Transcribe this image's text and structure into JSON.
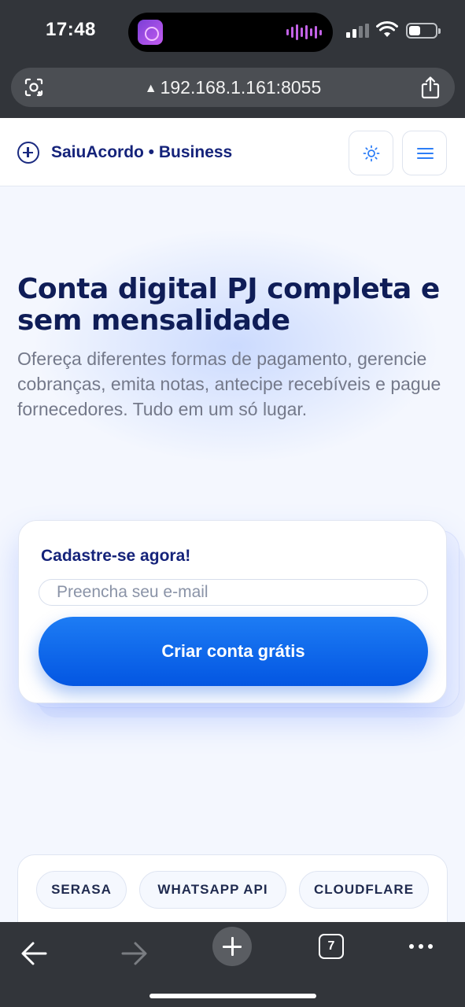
{
  "status_bar": {
    "time": "17:48"
  },
  "browser": {
    "url": "192.168.1.161:8055",
    "tab_count": "7"
  },
  "site": {
    "brand": "SaiuAcordo • Business"
  },
  "hero": {
    "title": "Conta digital PJ completa e sem mensalidade",
    "subtitle": "Ofereça diferentes formas de pagamento, gerencie cobranças, emita notas, antecipe recebíveis e pague fornecedores. Tudo em um só lugar."
  },
  "signup": {
    "title": "Cadastre-se agora!",
    "email_placeholder": "Preencha seu e-mail",
    "email_value": "",
    "cta": "Criar conta grátis"
  },
  "partners": [
    "SERASA",
    "WHATSAPP API",
    "CLOUDFLARE"
  ],
  "colors": {
    "brand_navy": "#15237a",
    "accent_blue": "#0a66ee",
    "page_bg": "#f4f7fe",
    "browser_chrome": "#32353a"
  }
}
